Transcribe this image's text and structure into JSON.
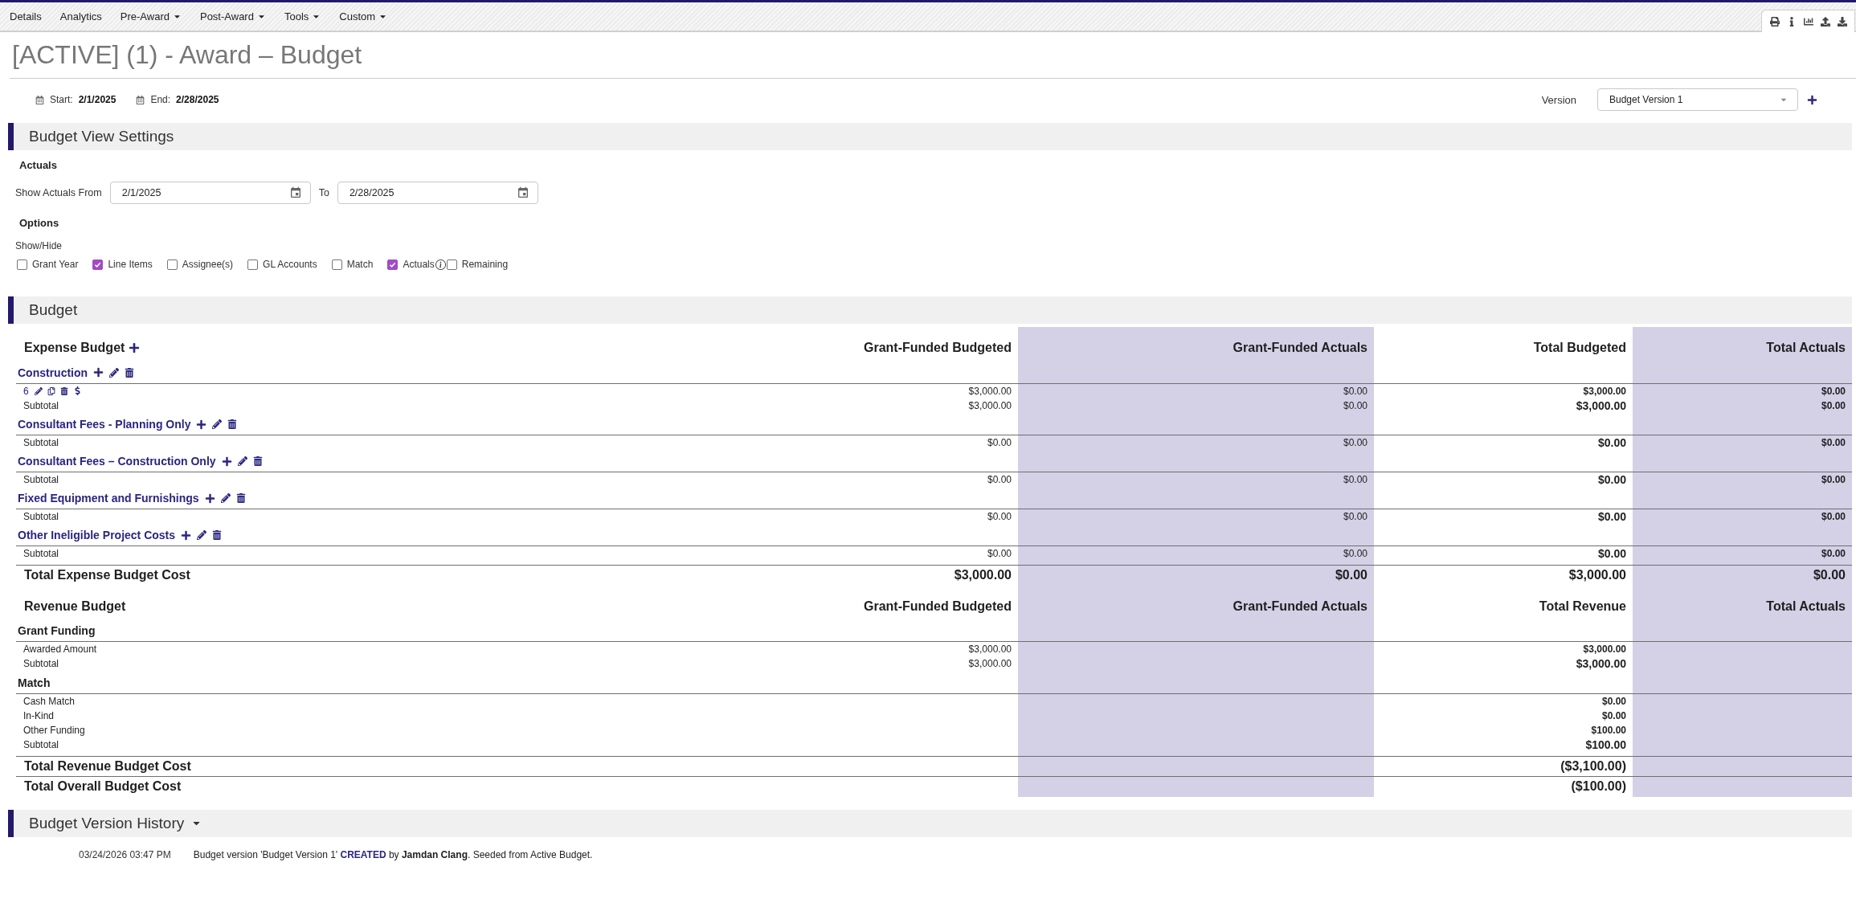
{
  "nav": {
    "items": [
      {
        "label": "Details",
        "has_menu": false
      },
      {
        "label": "Analytics",
        "has_menu": false
      },
      {
        "label": "Pre-Award",
        "has_menu": true
      },
      {
        "label": "Post-Award",
        "has_menu": true
      },
      {
        "label": "Tools",
        "has_menu": true
      },
      {
        "label": "Custom",
        "has_menu": true
      }
    ]
  },
  "page": {
    "title": "[ACTIVE] (1) - Award – Budget"
  },
  "period": {
    "start_label": "Start:",
    "start": "2/1/2025",
    "end_label": "End:",
    "end": "2/28/2025"
  },
  "version": {
    "label": "Version",
    "value": "Budget Version 1"
  },
  "view_settings": {
    "title": "Budget View Settings",
    "actuals_heading": "Actuals",
    "from_label": "Show Actuals From",
    "from": "2/1/2025",
    "to_label": "To",
    "to": "2/28/2025",
    "options_heading": "Options",
    "show_hide_label": "Show/Hide",
    "options": [
      {
        "label": "Grant Year",
        "checked": false,
        "has_info": false
      },
      {
        "label": "Line Items",
        "checked": true,
        "has_info": false
      },
      {
        "label": "Assignee(s)",
        "checked": false,
        "has_info": false
      },
      {
        "label": "GL Accounts",
        "checked": false,
        "has_info": false
      },
      {
        "label": "Match",
        "checked": false,
        "has_info": false
      },
      {
        "label": "Actuals",
        "checked": true,
        "has_info": true
      },
      {
        "label": "Remaining",
        "checked": false,
        "has_info": false
      }
    ]
  },
  "budget": {
    "title": "Budget",
    "sections": [
      {
        "title": "Expense Budget",
        "editable": true,
        "columns": [
          "Grant-Funded Budgeted",
          "Grant-Funded Actuals",
          "Total Budgeted",
          "Total Actuals"
        ],
        "groups": [
          {
            "name": "Construction",
            "items": [
              {
                "label": "6",
                "cells": {
                  "grant_funded_budgeted": "$3,000.00",
                  "grant_funded_actuals": "$0.00",
                  "total": "$3,000.00",
                  "total_actuals": "$0.00"
                }
              }
            ],
            "subtotal": {
              "label": "Subtotal",
              "cells": {
                "grant_funded_budgeted": "$3,000.00",
                "grant_funded_actuals": "$0.00",
                "total": "$3,000.00",
                "total_actuals": "$0.00"
              }
            }
          },
          {
            "name": "Consultant Fees - Planning Only",
            "subtotal": {
              "label": "Subtotal",
              "cells": {
                "grant_funded_budgeted": "$0.00",
                "grant_funded_actuals": "$0.00",
                "total": "$0.00",
                "total_actuals": "$0.00"
              }
            }
          },
          {
            "name": "Consultant Fees – Construction Only",
            "subtotal": {
              "label": "Subtotal",
              "cells": {
                "grant_funded_budgeted": "$0.00",
                "grant_funded_actuals": "$0.00",
                "total": "$0.00",
                "total_actuals": "$0.00"
              }
            }
          },
          {
            "name": "Fixed Equipment and Furnishings",
            "subtotal": {
              "label": "Subtotal",
              "cells": {
                "grant_funded_budgeted": "$0.00",
                "grant_funded_actuals": "$0.00",
                "total": "$0.00",
                "total_actuals": "$0.00"
              }
            }
          },
          {
            "name": "Other Ineligible Project Costs",
            "subtotal": {
              "label": "Subtotal",
              "cells": {
                "grant_funded_budgeted": "$0.00",
                "grant_funded_actuals": "$0.00",
                "total": "$0.00",
                "total_actuals": "$0.00"
              }
            }
          }
        ],
        "totals": [
          {
            "label": "Total Expense Budget Cost",
            "cells": {
              "grant_funded_budgeted": "$3,000.00",
              "grant_funded_actuals": "$0.00",
              "total": "$3,000.00",
              "total_actuals": "$0.00"
            }
          }
        ]
      },
      {
        "title": "Revenue Budget",
        "editable": false,
        "columns": [
          "Grant-Funded Budgeted",
          "Grant-Funded Actuals",
          "Total Revenue",
          "Total Actuals"
        ],
        "groups": [
          {
            "name": "Grant Funding",
            "items": [
              {
                "label": "Awarded Amount",
                "cells": {
                  "grant_funded_budgeted": "$3,000.00",
                  "total": "$3,000.00"
                }
              }
            ],
            "subtotal": {
              "label": "Subtotal",
              "cells": {
                "grant_funded_budgeted": "$3,000.00",
                "total": "$3,000.00"
              }
            }
          },
          {
            "name": "Match",
            "items": [
              {
                "label": "Cash Match",
                "cells": {
                  "total": "$0.00"
                }
              },
              {
                "label": "In-Kind",
                "cells": {
                  "total": "$0.00"
                }
              },
              {
                "label": "Other Funding",
                "cells": {
                  "total": "$100.00"
                }
              }
            ],
            "subtotal": {
              "label": "Subtotal",
              "cells": {
                "total": "$100.00"
              }
            }
          }
        ],
        "totals": [
          {
            "label": "Total Revenue Budget Cost",
            "cells": {
              "total": "($3,100.00)"
            }
          },
          {
            "label": "Total Overall Budget Cost",
            "cells": {
              "total": "($100.00)"
            }
          }
        ]
      }
    ]
  },
  "version_history": {
    "title": "Budget Version History",
    "has_menu": true,
    "entries": [
      {
        "time": "03/24/2026 03:47 PM",
        "text": "Budget version 'Budget Version 1' **CREATED** by **Jamdan Clang**. Seeded from Active Budget."
      }
    ]
  }
}
